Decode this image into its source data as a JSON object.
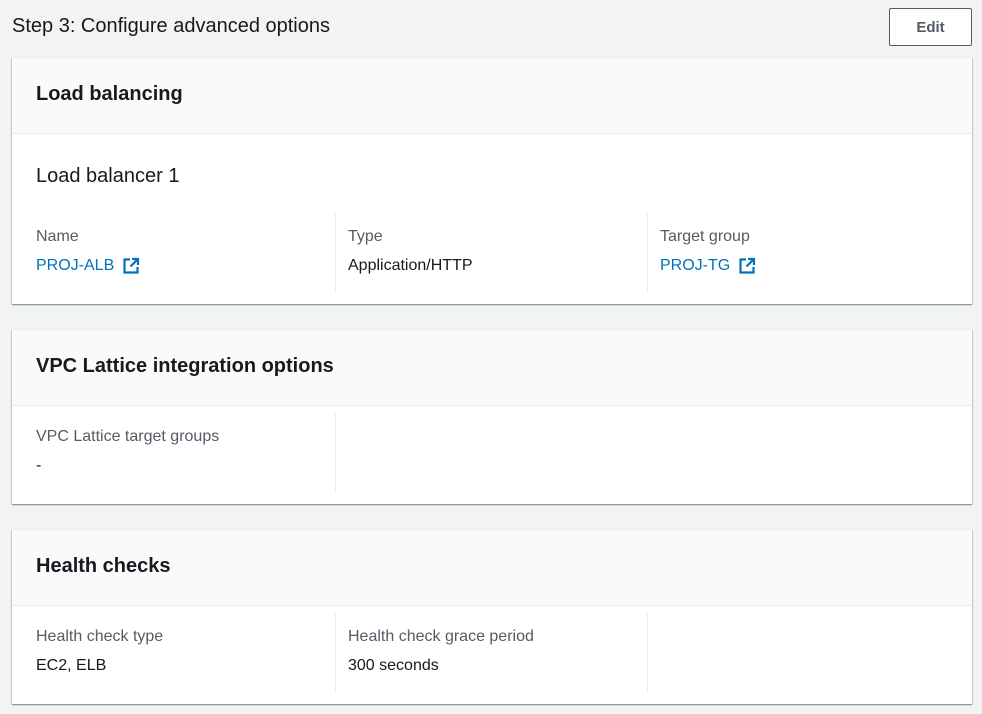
{
  "header": {
    "title": "Step 3: Configure advanced options",
    "edit_label": "Edit"
  },
  "load_balancing": {
    "title": "Load balancing",
    "subtitle": "Load balancer 1",
    "name_label": "Name",
    "name_value": "PROJ-ALB",
    "type_label": "Type",
    "type_value": "Application/HTTP",
    "target_group_label": "Target group",
    "target_group_value": "PROJ-TG"
  },
  "vpc_lattice": {
    "title": "VPC Lattice integration options",
    "target_groups_label": "VPC Lattice target groups",
    "target_groups_value": "-"
  },
  "health_checks": {
    "title": "Health checks",
    "type_label": "Health check type",
    "type_value": "EC2, ELB",
    "grace_label": "Health check grace period",
    "grace_value": "300 seconds"
  },
  "colors": {
    "link": "#0073bb",
    "label": "#545b64",
    "text": "#16191f",
    "background": "#f2f3f3",
    "panel_header": "#fafafa"
  },
  "icons": {
    "external_link": "external-link-icon"
  }
}
